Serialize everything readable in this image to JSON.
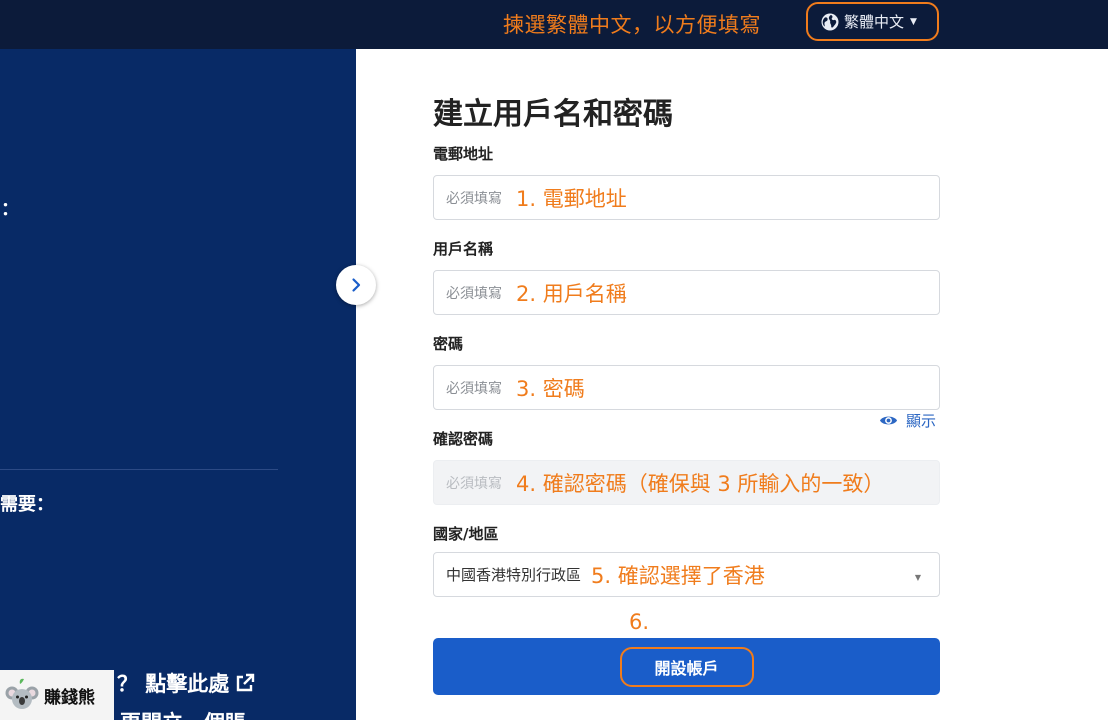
{
  "header": {
    "language_annotation": "揀選繁體中文，以方便填寫",
    "language_selector_label": "繁體中文",
    "icon": "globe-icon",
    "annotation_color": "#f07c1c"
  },
  "left_panel": {
    "colon_text": "：",
    "need_text": "需要：",
    "help_text": "？ 點擊此處",
    "help_icon": "external-link-icon",
    "cut_text": "更開立一個賬"
  },
  "form": {
    "title": "建立用戶名和密碼",
    "fields": [
      {
        "label": "電郵地址",
        "placeholder": "必須填寫",
        "annotation": "1. 電郵地址"
      },
      {
        "label": "用戶名稱",
        "placeholder": "必須填寫",
        "annotation": "2. 用戶名稱"
      },
      {
        "label": "密碼",
        "placeholder": "必須填寫",
        "annotation": "3. 密碼"
      },
      {
        "label": "確認密碼",
        "placeholder": "必須填寫",
        "annotation": "4. 確認密碼（確保與 3 所輸入的一致）"
      }
    ],
    "show_password_label": "顯示",
    "country": {
      "label": "國家/地區",
      "selected": "中國香港特別行政區",
      "annotation": "5. 確認選擇了香港"
    },
    "step6_annotation": "6.",
    "submit_label": "開設帳戶",
    "primary_color": "#1a5dc9"
  },
  "logo": {
    "name": "賺錢熊"
  }
}
